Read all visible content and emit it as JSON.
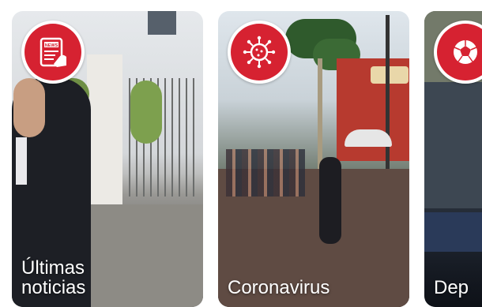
{
  "cards": [
    {
      "title_line1": "Últimas",
      "title_line2": "noticias",
      "icon": "news-tablet-icon"
    },
    {
      "title": "Coronavirus",
      "icon": "virus-icon"
    },
    {
      "title": "Dep",
      "icon": "soccer-ball-icon"
    }
  ],
  "colors": {
    "badge_red": "#d62231",
    "badge_ring": "#ffffff",
    "title_text": "#ffffff"
  }
}
